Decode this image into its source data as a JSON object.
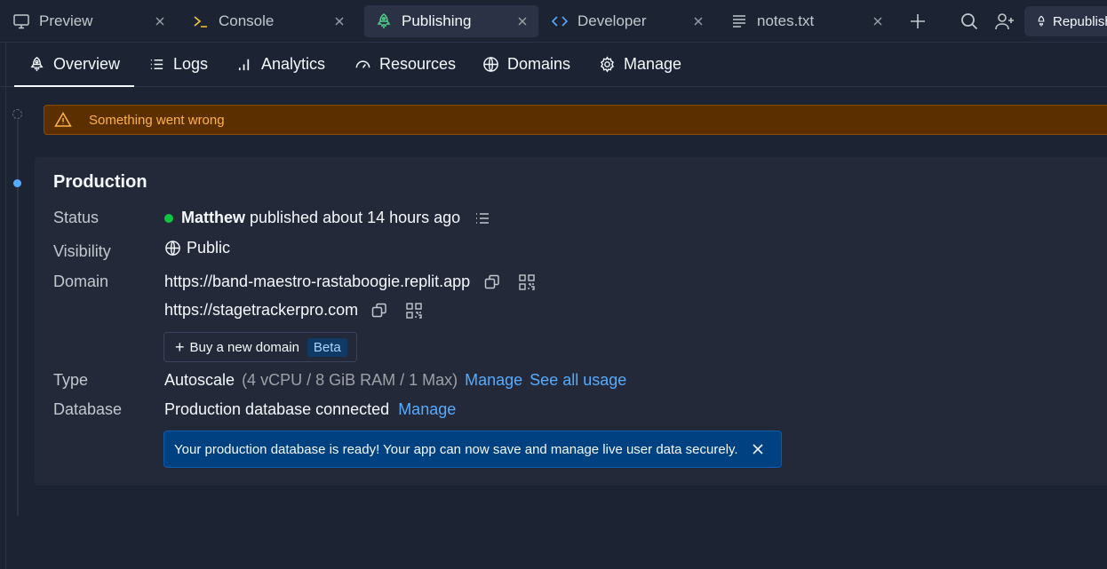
{
  "tabs": [
    {
      "label": "Preview",
      "icon": "monitor-icon",
      "active": false
    },
    {
      "label": "Console",
      "icon": "terminal-icon",
      "active": false
    },
    {
      "label": "Publishing",
      "icon": "rocket-icon",
      "active": true
    },
    {
      "label": "Developer",
      "icon": "code-icon",
      "active": false
    },
    {
      "label": "notes.txt",
      "icon": "file-text-icon",
      "active": false
    }
  ],
  "header": {
    "republish_label": "Republish"
  },
  "subnav": [
    {
      "label": "Overview",
      "icon": "rocket-icon",
      "active": true
    },
    {
      "label": "Logs",
      "icon": "list-icon",
      "active": false
    },
    {
      "label": "Analytics",
      "icon": "bar-chart-icon",
      "active": false
    },
    {
      "label": "Resources",
      "icon": "gauge-icon",
      "active": false
    },
    {
      "label": "Domains",
      "icon": "globe-icon",
      "active": false
    },
    {
      "label": "Manage",
      "icon": "gear-icon",
      "active": false
    }
  ],
  "error_banner": {
    "text": "Something went wrong"
  },
  "production": {
    "title": "Production",
    "status": {
      "label": "Status",
      "user": "Matthew",
      "text": "published about 14 hours ago"
    },
    "visibility": {
      "label": "Visibility",
      "value": "Public"
    },
    "domain": {
      "label": "Domain",
      "urls": [
        "https://band-maestro-rastaboogie.replit.app",
        "https://stagetrackerpro.com"
      ],
      "buy_label": "Buy a new domain",
      "beta_badge": "Beta"
    },
    "type": {
      "label": "Type",
      "value": "Autoscale",
      "specs": "(4 vCPU / 8 GiB RAM / 1 Max)",
      "manage_link": "Manage",
      "usage_link": "See all usage"
    },
    "database": {
      "label": "Database",
      "value": "Production database connected",
      "manage_link": "Manage",
      "notice": "Your production database is ready! Your app can now save and manage live user data securely."
    }
  },
  "colors": {
    "background": "#1c2333",
    "card": "#232939",
    "accent_link": "#57abff",
    "status_green": "#0ec53f",
    "warning_bg": "#5c2f00",
    "warning_text": "#ffb14d",
    "info_bg": "#004182"
  }
}
